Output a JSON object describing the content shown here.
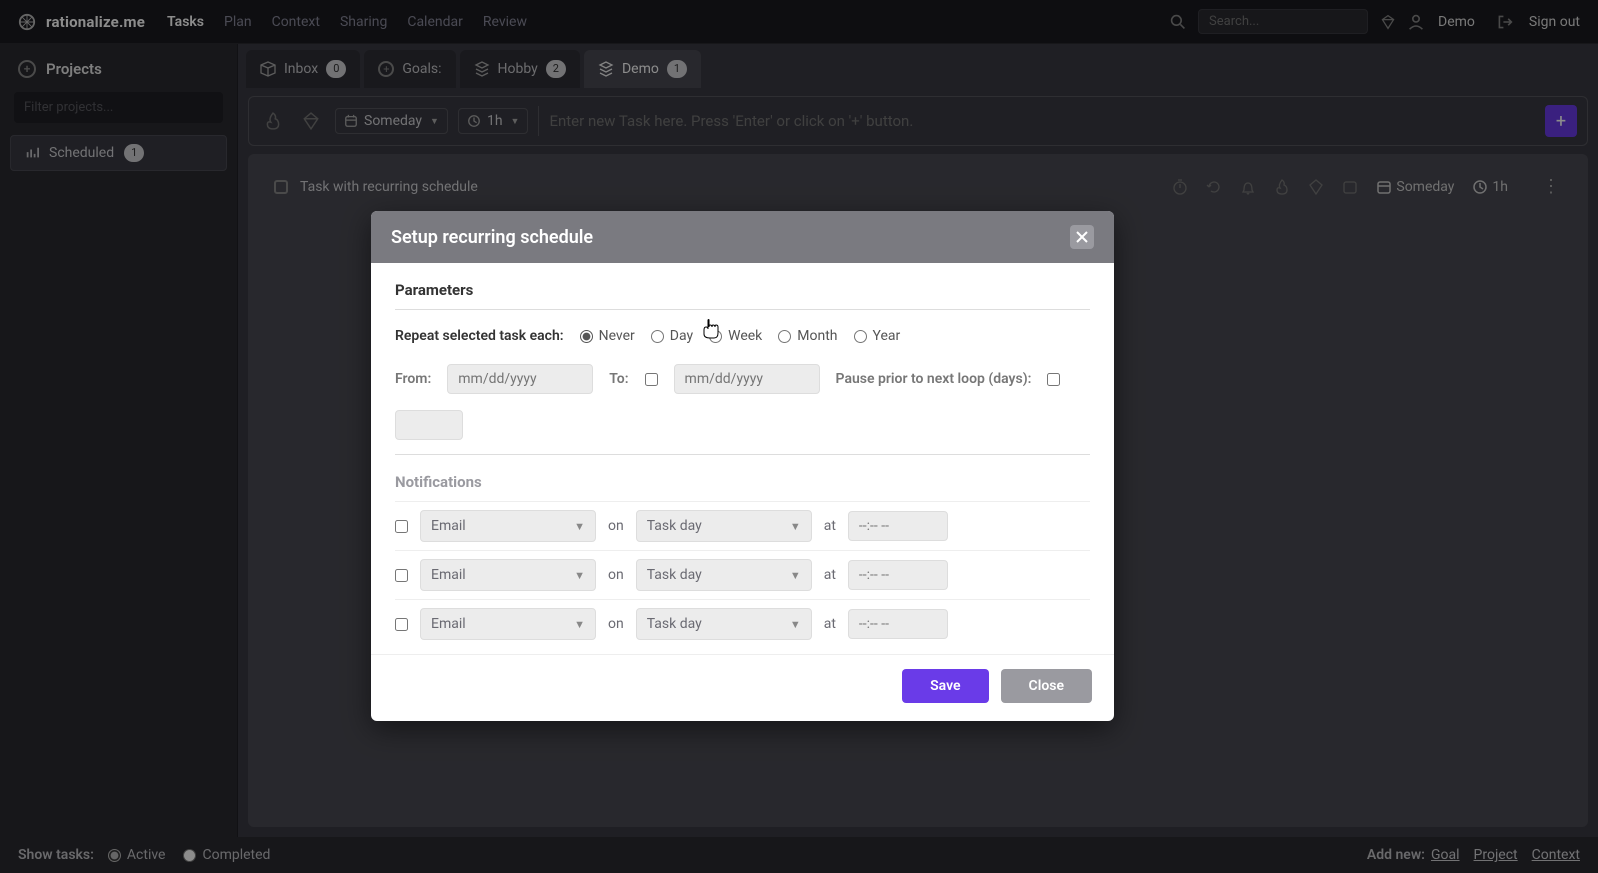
{
  "brand": "rationalize.me",
  "nav": [
    "Tasks",
    "Plan",
    "Context",
    "Sharing",
    "Calendar",
    "Review"
  ],
  "nav_active": "Tasks",
  "search": {
    "placeholder": "Search..."
  },
  "user": {
    "name": "Demo",
    "signout": "Sign out"
  },
  "sidebar": {
    "title": "Projects",
    "filter_placeholder": "Filter projects...",
    "scheduled_label": "Scheduled",
    "scheduled_count": "1"
  },
  "tabs": [
    {
      "icon": "inbox",
      "label": "Inbox",
      "count": "0"
    },
    {
      "icon": "plus",
      "label": "Goals:"
    },
    {
      "icon": "stack",
      "label": "Hobby",
      "count": "2"
    },
    {
      "icon": "stack",
      "label": "Demo",
      "count": "1",
      "active": true
    }
  ],
  "toolbar": {
    "someday": "Someday",
    "duration": "1h",
    "task_input_placeholder": "Enter new Task here. Press 'Enter' or click on '+' button."
  },
  "task_row": {
    "title": "Task with recurring schedule",
    "someday": "Someday",
    "duration": "1h"
  },
  "modal": {
    "title": "Setup recurring schedule",
    "parameters": "Parameters",
    "repeat_label": "Repeat selected task each:",
    "repeat_options": [
      "Never",
      "Day",
      "Week",
      "Month",
      "Year"
    ],
    "repeat_selected": "Never",
    "from_label": "From:",
    "from_placeholder": "mm/dd/yyyy",
    "to_label": "To:",
    "to_placeholder": "mm/dd/yyyy",
    "pause_label": "Pause prior to next loop (days):",
    "notifications": "Notifications",
    "notif_method": "Email",
    "notif_on": "on",
    "notif_day": "Task day",
    "notif_at": "at",
    "notif_time": "--:-- --",
    "save": "Save",
    "close": "Close"
  },
  "bottom": {
    "show_tasks": "Show tasks:",
    "active": "Active",
    "completed": "Completed",
    "add_new": "Add new:",
    "links": [
      "Goal",
      "Project",
      "Context"
    ]
  }
}
